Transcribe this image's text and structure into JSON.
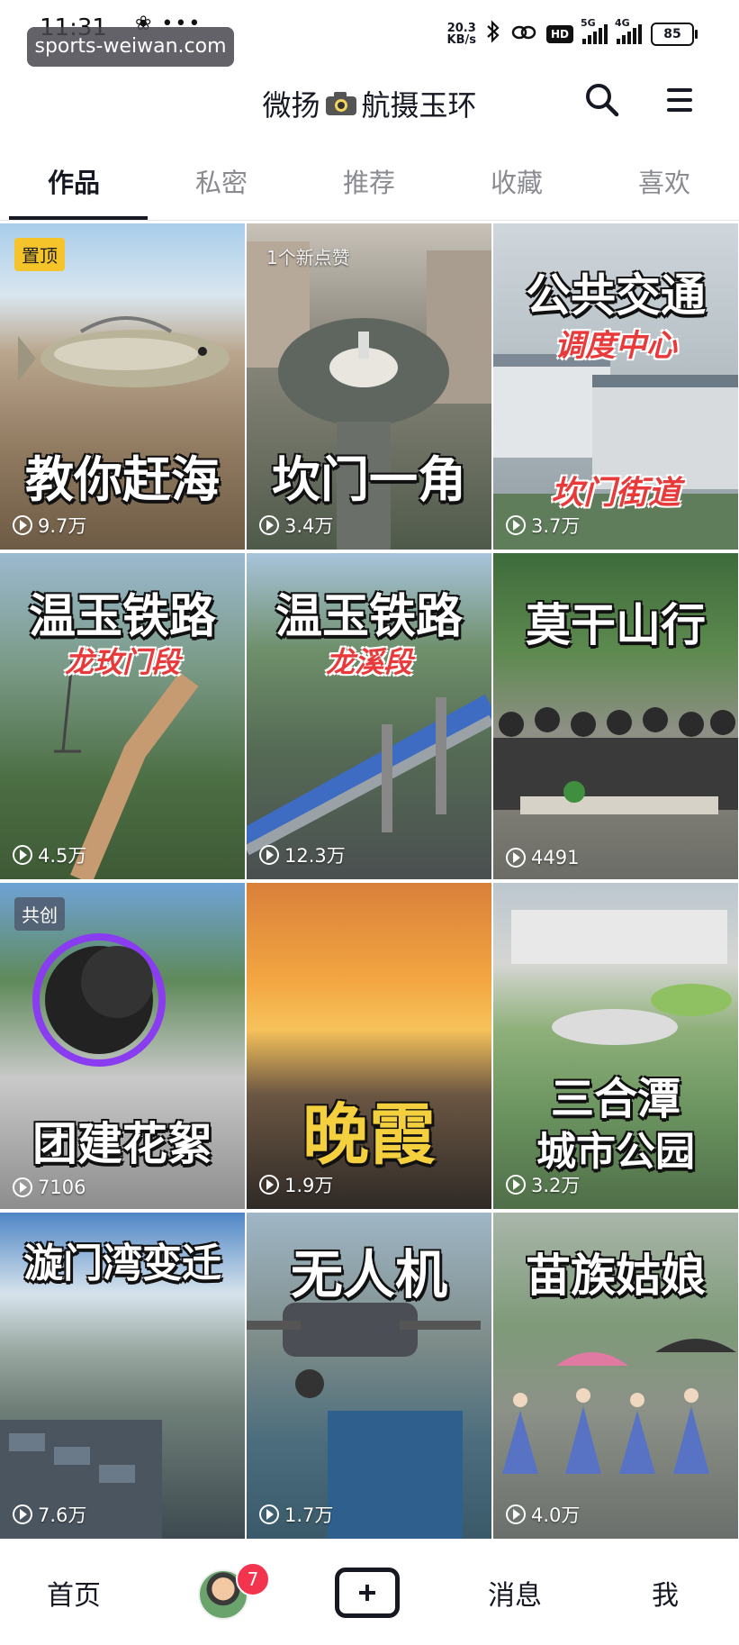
{
  "status_bar": {
    "time": "11:31",
    "indicators": "❀ •••",
    "watermark": "sports-weiwan.com",
    "net_speed_value": "20.3",
    "net_speed_unit": "KB/s",
    "hd_label": "HD",
    "sig1_label": "5G",
    "sig2_label": "4G",
    "battery": "85"
  },
  "header": {
    "title_left": "微扬",
    "title_right": "航摄玉环",
    "camera_emoji_name": "camera-icon",
    "search_icon": "search-icon",
    "menu_icon": "hamburger-menu-icon"
  },
  "tabs": [
    {
      "label": "作品",
      "active": true
    },
    {
      "label": "私密",
      "active": false
    },
    {
      "label": "推荐",
      "active": false
    },
    {
      "label": "收藏",
      "active": false
    },
    {
      "label": "喜欢",
      "active": false
    }
  ],
  "videos": [
    {
      "title": "教你赶海",
      "views": "9.7万",
      "badge": "置顶",
      "theme": "sea"
    },
    {
      "title": "坎门一角",
      "views": "3.4万",
      "note": "1个新点赞",
      "theme": "town"
    },
    {
      "title": "公共交通",
      "subtitle": "调度中心",
      "caption2": "坎门街道",
      "views": "3.7万",
      "theme": "building"
    },
    {
      "title": "温玉铁路",
      "subtitle": "龙玫门段",
      "views": "4.5万",
      "theme": "mountain"
    },
    {
      "title": "温玉铁路",
      "subtitle": "龙溪段",
      "views": "12.3万",
      "theme": "bridge"
    },
    {
      "title": "莫干山行",
      "views": "4491",
      "theme": "crowd"
    },
    {
      "title": "团建花絮",
      "views": "7106",
      "badge": "共创",
      "theme": "drone"
    },
    {
      "title": "晚霞",
      "views": "1.9万",
      "theme": "sunset"
    },
    {
      "title": "三合潭",
      "subtitle2": "城市公园",
      "views": "3.2万",
      "theme": "park"
    },
    {
      "title": "漩门湾变迁",
      "views": "7.6万",
      "theme": "bay"
    },
    {
      "title": "无人机",
      "views": "1.7万",
      "theme": "uav"
    },
    {
      "title": "苗族姑娘",
      "views": "4.0万",
      "theme": "miao"
    }
  ],
  "bottom_nav": {
    "home": "首页",
    "badge_count": "7",
    "messages": "消息",
    "me": "我"
  },
  "colors": {
    "text": "#161823",
    "muted": "#8a8b91",
    "badge_red": "#f2344e",
    "pin_yellow": "#f5c42a"
  }
}
